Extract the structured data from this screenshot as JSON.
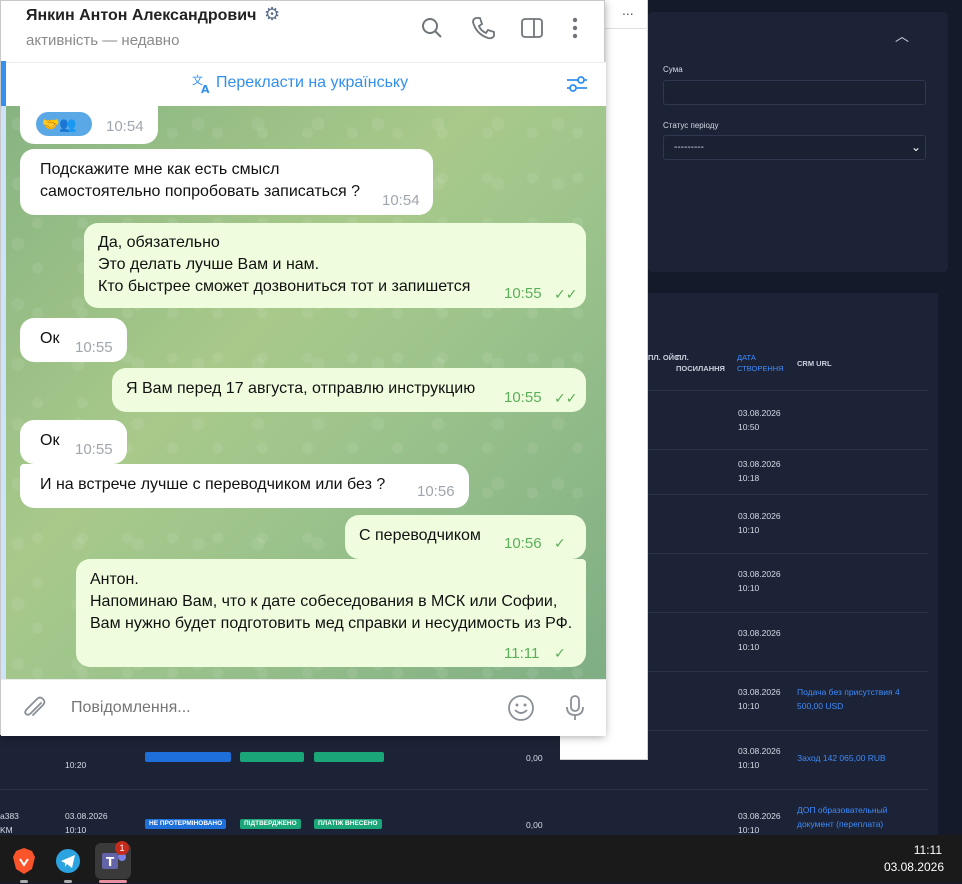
{
  "crm": {
    "filter": {
      "sum_label": "Сума",
      "status_label": "Статус періоду",
      "status_value": "---------"
    },
    "table": {
      "headers": [
        "ПЛ. ОЙС",
        "ПЛ. ПОСИЛАННЯ",
        "ДАТА СТВОРЕННЯ",
        "CRM URL"
      ],
      "rows": [
        {
          "date": "03.08.2026",
          "time": "10:50",
          "crm": ""
        },
        {
          "date": "03.08.2026",
          "time": "10:18",
          "crm": ""
        },
        {
          "date": "03.08.2026",
          "time": "10:10",
          "crm": ""
        },
        {
          "date": "03.08.2026",
          "time": "10:10",
          "crm": ""
        },
        {
          "date": "03.08.2026",
          "time": "10:10",
          "crm": ""
        },
        {
          "date": "03.08.2026",
          "time": "10:10",
          "crm": "Подача без присутствия 4 500,00 USD"
        },
        {
          "date": "03.08.2026",
          "time": "10:10",
          "crm": "Заход 142 065,00 RUB"
        },
        {
          "date": "03.08.2026",
          "time": "10:10",
          "crm": "ДОП образовательный документ (переплата)"
        }
      ],
      "bottom_rows": [
        {
          "left": "",
          "date": "",
          "time": "10:20",
          "amount": "0,00"
        },
        {
          "left": "a383 KM",
          "date": "03.08.2026",
          "time": "10:10",
          "amount": "0,00"
        }
      ],
      "badges": [
        "НЕ ПРОТЕРМІНОВАНО",
        "ПІДТВЕРДЖЕНО",
        "ПЛАТІЖ ВНЕСЕНО"
      ]
    }
  },
  "popup": {
    "menu": "..."
  },
  "telegram": {
    "header": {
      "name": "Янкин Антон Александрович",
      "status": "активність — недавно",
      "verified_icon": "gear-badge-icon"
    },
    "translate_bar": "Перекласти на українську",
    "messages": [
      {
        "dir": "in",
        "text": "🤝👥",
        "time": "10:54"
      },
      {
        "dir": "in",
        "text": "Подскажите мне как есть смысл самостоятельно попробовать записаться ?",
        "time": "10:54"
      },
      {
        "dir": "out",
        "text": "Да, обязательно\nЭто делать лучше Вам и нам.\nКто быстрее сможет дозвониться тот и запишется",
        "time": "10:55"
      },
      {
        "dir": "in",
        "text": "Ок",
        "time": "10:55"
      },
      {
        "dir": "out",
        "text": "Я Вам перед 17 августа, отправлю инструкцию",
        "time": "10:55"
      },
      {
        "dir": "in",
        "text": "Ок",
        "time": "10:55"
      },
      {
        "dir": "in",
        "text": "И на встрече лучше с переводчиком или без ?",
        "time": "10:56"
      },
      {
        "dir": "out",
        "text": "С переводчиком",
        "time": "10:56"
      },
      {
        "dir": "out",
        "text": "Антон.\nНапоминаю Вам, что к дате собеседования в МСК или Софии, Вам нужно будет подготовить мед справки и несудимость из РФ.",
        "time": "11:11"
      }
    ],
    "composer_placeholder": "Повідомлення..."
  },
  "taskbar": {
    "apps": [
      "brave",
      "telegram",
      "teams"
    ],
    "teams_badge": "1",
    "time": "11:11",
    "date": "03.08.2026"
  },
  "colors": {
    "telegram_accent": "#3390ec",
    "outgoing_bubble": "#effdde",
    "crm_bg": "#141a29",
    "crm_link": "#3d8bfd"
  }
}
